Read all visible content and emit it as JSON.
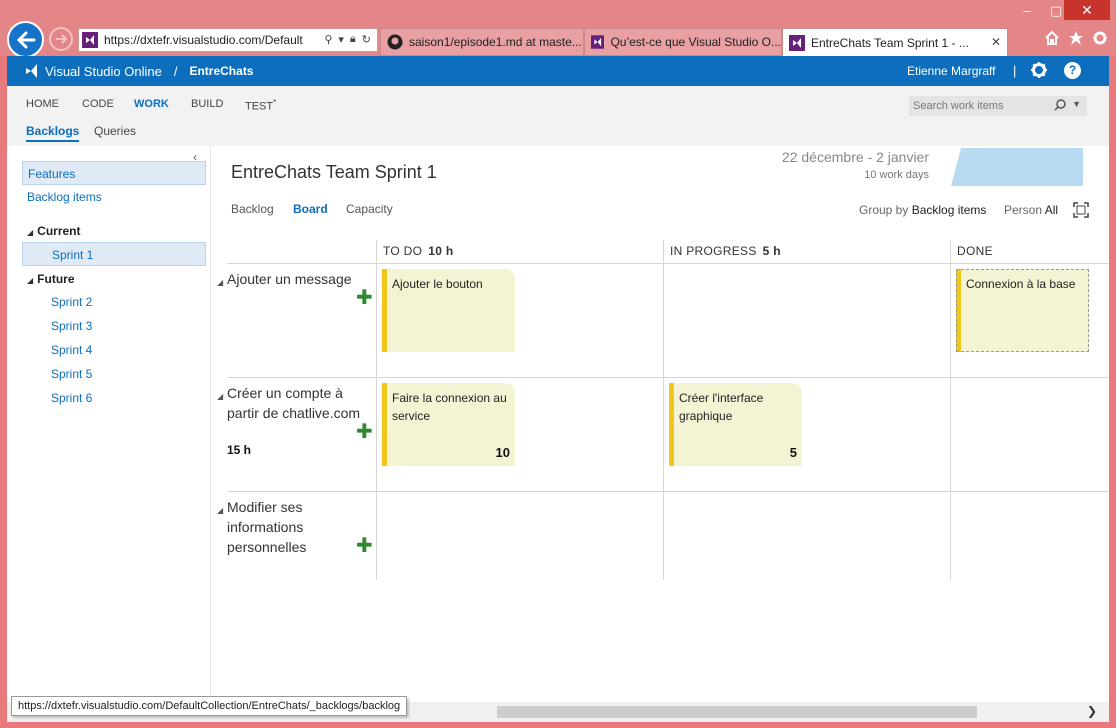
{
  "browser": {
    "url": "https://dxtefr.visualstudio.com/Default",
    "tabs": [
      {
        "label": "saison1/episode1.md at maste..."
      },
      {
        "label": "Qu’est-ce que Visual Studio O..."
      },
      {
        "label": "EntreChats Team Sprint 1 - ..."
      }
    ],
    "status_url": "https://dxtefr.visualstudio.com/DefaultCollection/EntreChats/_backlogs/backlog"
  },
  "header": {
    "brand": "Visual Studio Online",
    "separator": "/",
    "project": "EntreChats",
    "user": "Etienne Margraff",
    "pipe": "|",
    "help": "?"
  },
  "nav": {
    "items": [
      "HOME",
      "CODE",
      "WORK",
      "BUILD",
      "TEST"
    ],
    "test_marker": "*",
    "selected": "WORK",
    "search_placeholder": "Search work items",
    "subitems": [
      "Backlogs",
      "Queries"
    ]
  },
  "sidebar": {
    "items": [
      "Features",
      "Backlog items"
    ],
    "current_label": "Current",
    "current_sprints": [
      "Sprint 1"
    ],
    "future_label": "Future",
    "future_sprints": [
      "Sprint 2",
      "Sprint 3",
      "Sprint 4",
      "Sprint 5",
      "Sprint 6"
    ]
  },
  "main": {
    "title": "EntreChats Team Sprint 1",
    "dates": "22 décembre - 2 janvier",
    "work_days": "10 work days",
    "views": [
      "Backlog",
      "Board",
      "Capacity"
    ],
    "group_by_label": "Group by",
    "group_by_value": "Backlog items",
    "person_label": "Person",
    "person_value": "All"
  },
  "board": {
    "columns": [
      {
        "name": "TO DO",
        "hours": "10 h"
      },
      {
        "name": "IN PROGRESS",
        "hours": "5 h"
      },
      {
        "name": "DONE",
        "hours": ""
      }
    ],
    "rows": [
      {
        "title": "Ajouter un message",
        "hours": ""
      },
      {
        "title": "Créer un compte à partir de chatlive.com",
        "hours": "15 h"
      },
      {
        "title": "Modifier ses informations personnelles",
        "hours": ""
      }
    ],
    "cards": [
      {
        "title": "Ajouter le bouton",
        "estimate": ""
      },
      {
        "title": "Connexion à la base",
        "estimate": ""
      },
      {
        "title": "Faire la connexion au service",
        "estimate": "10"
      },
      {
        "title": "Créer l'interface graphique",
        "estimate": "5"
      }
    ]
  },
  "colors": {
    "accent": "#0c6ebc",
    "card_bar": "#efc61c",
    "card_bg": "#f4f4d4",
    "plus": "#2f8a2f",
    "chrome": "#e48587"
  }
}
